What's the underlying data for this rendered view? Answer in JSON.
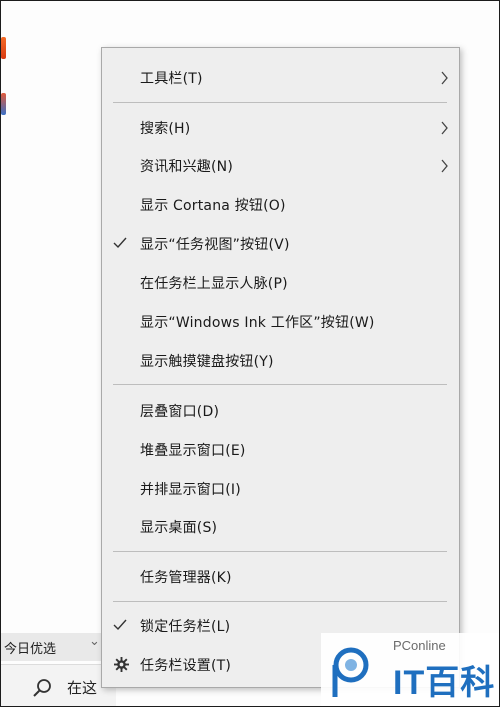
{
  "menu": {
    "items": [
      {
        "label": "工具栏(T)",
        "submenu": true,
        "checked": false
      },
      {
        "label": "搜索(H)",
        "submenu": true,
        "checked": false
      },
      {
        "label": "资讯和兴趣(N)",
        "submenu": true,
        "checked": false
      },
      {
        "label": "显示 Cortana 按钮(O)",
        "submenu": false,
        "checked": false
      },
      {
        "label": "显示“任务视图”按钮(V)",
        "submenu": false,
        "checked": true
      },
      {
        "label": "在任务栏上显示人脉(P)",
        "submenu": false,
        "checked": false
      },
      {
        "label": "显示“Windows Ink 工作区”按钮(W)",
        "submenu": false,
        "checked": false
      },
      {
        "label": "显示触摸键盘按钮(Y)",
        "submenu": false,
        "checked": false
      },
      {
        "label": "层叠窗口(D)",
        "submenu": false,
        "checked": false
      },
      {
        "label": "堆叠显示窗口(E)",
        "submenu": false,
        "checked": false
      },
      {
        "label": "并排显示窗口(I)",
        "submenu": false,
        "checked": false
      },
      {
        "label": "显示桌面(S)",
        "submenu": false,
        "checked": false
      },
      {
        "label": "任务管理器(K)",
        "submenu": false,
        "checked": false
      },
      {
        "label": "锁定任务栏(L)",
        "submenu": false,
        "checked": true
      },
      {
        "label": "任务栏设置(T)",
        "submenu": false,
        "checked": false,
        "icon": "gear-icon"
      }
    ]
  },
  "taskbar": {
    "news_text": "今日优选",
    "news_chevron_icon": "chevron-down-icon",
    "search_text": "在这",
    "search_icon": "search-icon"
  },
  "watermark": {
    "line1": "PConline",
    "line2": "IT百科"
  },
  "colors": {
    "menu_bg": "#eeeeee",
    "separator": "#bdbdbd",
    "brand_blue": "#1f6fbf"
  }
}
